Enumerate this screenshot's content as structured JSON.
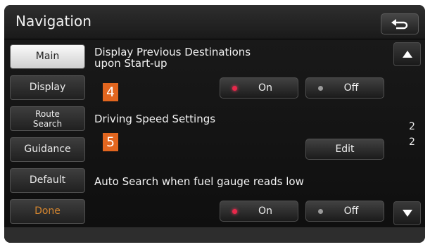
{
  "header": {
    "title": "Navigation",
    "back_icon": "return-arrow-icon"
  },
  "sidebar": {
    "items": [
      {
        "label": "Main",
        "active": true
      },
      {
        "label": "Display"
      },
      {
        "line1": "Route",
        "line2": "Search"
      },
      {
        "label": "Guidance"
      },
      {
        "label": "Default"
      },
      {
        "label": "Done",
        "color": "#d3852f"
      }
    ]
  },
  "settings": {
    "previous_destinations": {
      "label_line1": "Display Previous Destinations",
      "label_line2": "upon Start-up",
      "on_label": "On",
      "off_label": "Off",
      "selected": "On"
    },
    "driving_speed": {
      "label": "Driving Speed Settings",
      "edit_label": "Edit"
    },
    "auto_search": {
      "label": "Auto Search when fuel gauge reads low",
      "on_label": "On",
      "off_label": "Off",
      "selected": "On"
    }
  },
  "badges": {
    "b4": "4",
    "b5": "5",
    "color": "#e2661f"
  },
  "scroll": {
    "up_icon": "triangle-up-icon",
    "down_icon": "triangle-down-icon",
    "page_a": "2",
    "page_b": "2"
  },
  "colors": {
    "on_indicator": "#e8284a",
    "done_text": "#d3852f"
  }
}
